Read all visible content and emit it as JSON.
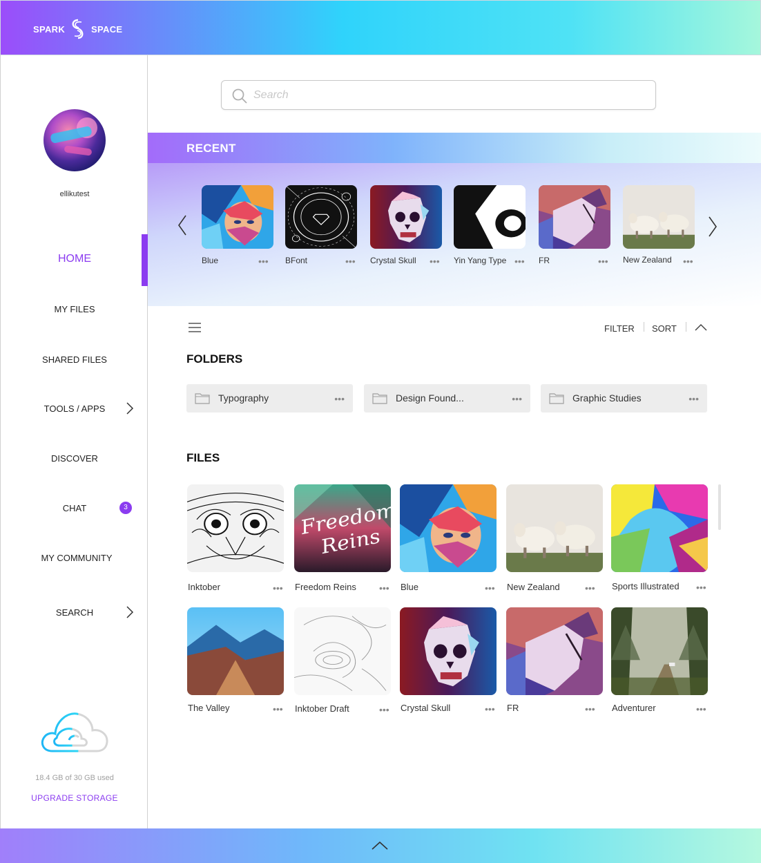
{
  "header": {
    "logo_left": "SPARK",
    "logo_right": "SPACE"
  },
  "user": {
    "username": "ellikutest"
  },
  "nav": {
    "home": "HOME",
    "my_files": "MY FILES",
    "shared_files": "SHARED FILES",
    "tools_apps": "TOOLS / APPS",
    "discover": "DISCOVER",
    "chat": "CHAT",
    "chat_badge": "3",
    "my_community": "MY COMMUNITY",
    "search": "SEARCH"
  },
  "storage": {
    "usage_text": "18.4 GB of 30 GB used",
    "upgrade_label": "UPGRADE STORAGE"
  },
  "search": {
    "placeholder": "Search"
  },
  "recent": {
    "title": "RECENT",
    "items": [
      {
        "label": "Blue",
        "art": "portrait-blue"
      },
      {
        "label": "BFont",
        "art": "bfont-circle"
      },
      {
        "label": "Crystal Skull",
        "art": "skull"
      },
      {
        "label": "Yin Yang Type",
        "art": "yinyang"
      },
      {
        "label": "FR",
        "art": "horse"
      },
      {
        "label": "New Zealand",
        "art": "sheep"
      }
    ],
    "more": "•••"
  },
  "toolbar": {
    "filter": "FILTER",
    "sort": "SORT"
  },
  "folders": {
    "title": "FOLDERS",
    "items": [
      {
        "name": "Typography"
      },
      {
        "name": "Design Found..."
      },
      {
        "name": "Graphic Studies"
      }
    ]
  },
  "files": {
    "title": "FILES",
    "items": [
      {
        "label": "Inktober",
        "art": "owl"
      },
      {
        "label": "Freedom Reins",
        "art": "freedom"
      },
      {
        "label": "Blue",
        "art": "portrait-blue"
      },
      {
        "label": "New Zealand",
        "art": "sheep"
      },
      {
        "label": "Sports Illustrated",
        "art": "sports"
      },
      {
        "label": "The Valley",
        "art": "valley"
      },
      {
        "label": "Inktober Draft",
        "art": "sketch"
      },
      {
        "label": "Crystal Skull",
        "art": "skull"
      },
      {
        "label": "FR",
        "art": "horse"
      },
      {
        "label": "Adventurer",
        "art": "forest"
      }
    ]
  },
  "freedom_art_text": {
    "line1": "Freedom",
    "line2": "Reins"
  },
  "colors": {
    "accent": "#8b3cf0",
    "folder_bg": "#ededed"
  }
}
